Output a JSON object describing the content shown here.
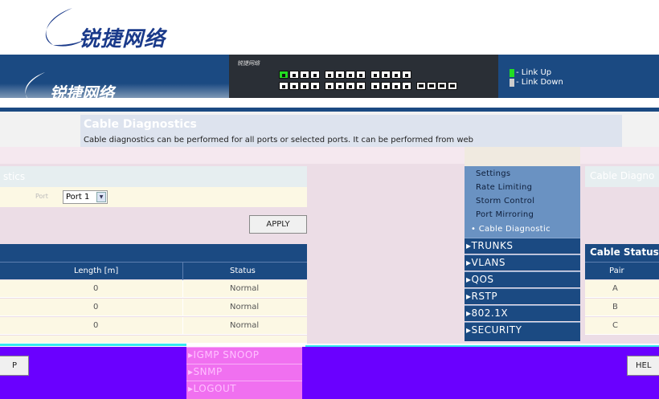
{
  "branding": {
    "logo_text": "锐捷网络",
    "switch_brand": "锐捷网络"
  },
  "legend": {
    "link_up": "- Link Up",
    "link_down": "- Link Down",
    "up_color": "#22dd22",
    "down_color": "#cccccc"
  },
  "page": {
    "title": "Cable Diagnostics",
    "description": "Cable diagnostics can be performed for all ports or selected ports. It can be performed from web"
  },
  "form": {
    "section_title": "stics",
    "port_label": "Port",
    "port_value": "Port 1",
    "apply_label": "APPLY"
  },
  "table": {
    "headers": [
      "Length [m]",
      "Status"
    ],
    "rows": [
      {
        "length": "0",
        "status": "Normal"
      },
      {
        "length": "0",
        "status": "Normal"
      },
      {
        "length": "0",
        "status": "Normal"
      }
    ]
  },
  "menu": {
    "sub_items": [
      "Settings",
      "Rate Limiting",
      "Storm Control",
      "Port Mirroring",
      "Cable Diagnostic"
    ],
    "active_sub": "Cable Diagnostic",
    "items": [
      "TRUNKS",
      "VLANS",
      "QOS",
      "RSTP",
      "802.1X",
      "SECURITY"
    ],
    "bottom_items": [
      "IGMP SNOOP",
      "SNMP",
      "LOGOUT"
    ]
  },
  "right_panel": {
    "section_title": "Cable Diagno",
    "title": "Cable Status",
    "column": "Pair",
    "pairs": [
      "A",
      "B",
      "C"
    ]
  },
  "buttons": {
    "left_partial": "P",
    "right_partial": "HEL"
  }
}
